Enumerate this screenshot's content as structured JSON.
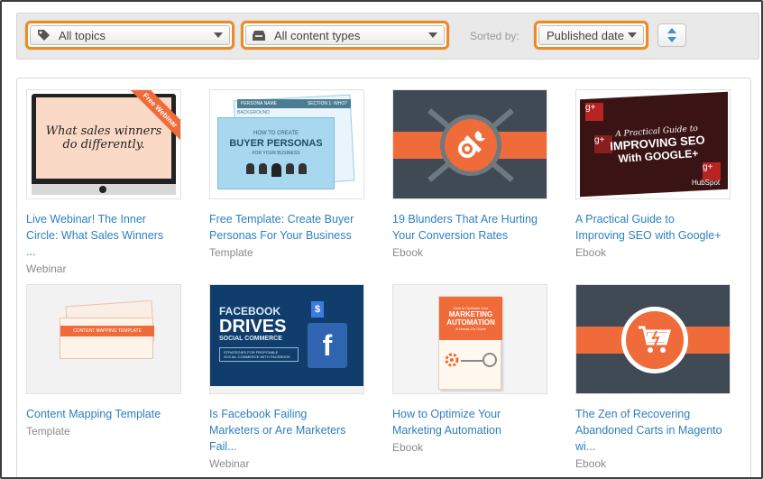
{
  "filters": {
    "topics": "All topics",
    "content_types": "All content types",
    "sorted_by_label": "Sorted by:",
    "sort_value": "Published date"
  },
  "cards": [
    {
      "title": "Live Webinar! The Inner Circle: What Sales Winners ...",
      "title_lines": [
        "Live Webinar! The Inner",
        "Circle: What Sales Winners",
        "..."
      ],
      "type": "Webinar",
      "thumb": {
        "screen_text_1": "What sales winners",
        "screen_text_2": "do differently.",
        "ribbon": "Free Webinar"
      }
    },
    {
      "title": "Free Template: Create Buyer Personas For Your Business",
      "title_lines": [
        "Free Template: Create Buyer",
        "Personas For Your Business"
      ],
      "type": "Template",
      "thumb": {
        "line1": "HOW TO CREATE",
        "line2": "BUYER PERSONAS",
        "line3": "FOR YOUR BUSINESS",
        "tab1": "PERSONA NAME",
        "tab2": "SECTION 1: WHO?",
        "tab3": "BACKGROUND"
      }
    },
    {
      "title": "19 Blunders That Are Hurting Your Conversion Rates",
      "title_lines": [
        "19 Blunders That Are Hurting",
        "Your Conversion Rates"
      ],
      "type": "Ebook",
      "thumb": {}
    },
    {
      "title": "A Practical Guide to Improving SEO with Google+",
      "title_lines": [
        "A Practical Guide to",
        "Improving SEO with Google+"
      ],
      "type": "Ebook",
      "thumb": {
        "line1": "A Practical Guide to",
        "line2": "IMPROVING SEO",
        "line3": "With GOOGLE+",
        "brand": "HubSpot",
        "g_glyph": "g+"
      }
    },
    {
      "title": "Content Mapping Template",
      "title_lines": [
        "Content Mapping Template"
      ],
      "type": "Template",
      "thumb": {
        "label": "CONTENT MAPPING TEMPLATE"
      }
    },
    {
      "title": "Is Facebook Failing Marketers or Are Marketers Fail...",
      "title_lines": [
        "Is Facebook Failing",
        "Marketers or Are Marketers",
        "Fail..."
      ],
      "type": "Webinar",
      "thumb": {
        "line1": "FACEBOOK",
        "line2": "DRIVES",
        "line3": "SOCIAL COMMERCE",
        "line4": "STRATEGIES FOR PROFITABLE",
        "line5": "SOCIAL COMMERCE WITH FACEBOOK",
        "fb": "f",
        "tag": "$"
      }
    },
    {
      "title": "How to Optimize Your Marketing Automation",
      "title_lines": [
        "How to Optimize Your",
        "Marketing Automation"
      ],
      "type": "Ebook",
      "thumb": {
        "line0": "How to Optimize Your",
        "line1": "MARKETING",
        "line2": "AUTOMATION",
        "line3": "A Hands-On Guide"
      }
    },
    {
      "title": "The Zen of Recovering Abandoned Carts in Magento wi...",
      "title_lines": [
        "The Zen of Recovering",
        "Abandoned Carts in Magento",
        "wi..."
      ],
      "type": "Ebook",
      "thumb": {}
    }
  ],
  "colors": {
    "accent_orange": "#f0891e",
    "link_blue": "#2c7fc1",
    "brand_orange": "#ef6c3a",
    "dark_slate": "#3f4a54"
  }
}
